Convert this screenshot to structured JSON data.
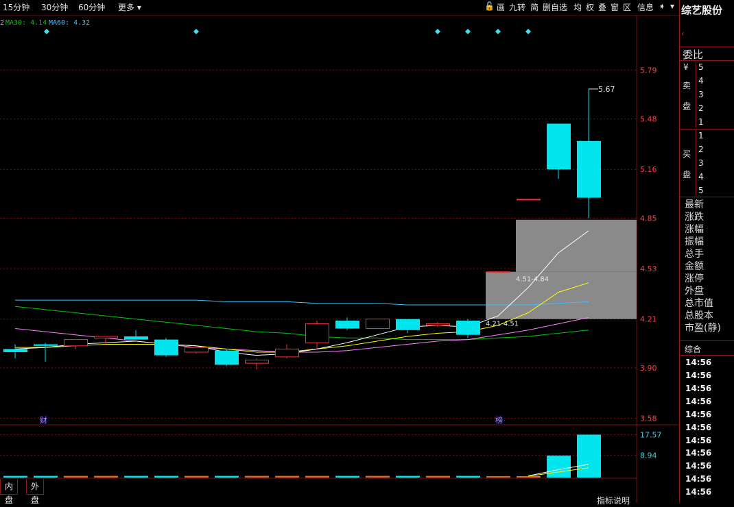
{
  "toolbar": {
    "left": [
      "15分钟",
      "30分钟",
      "60分钟",
      "更多"
    ],
    "right": [
      "画",
      "九转",
      "简",
      "删自选",
      "均",
      "权",
      "叠",
      "窗",
      "区",
      "信息"
    ]
  },
  "stock": {
    "name": "综艺股份"
  },
  "ma_label": {
    "prefix": "2",
    "ma30": "MA30: 4.14",
    "ma60": "MA60: 4.32"
  },
  "colors": {
    "up": "#ff3030",
    "down": "#00e5ee",
    "grid": "#7a1010",
    "ma5": "#ffffff",
    "ma10": "#ffff00",
    "ma20": "#ff80ff",
    "ma30": "#00cc00",
    "ma60": "#40c0ff"
  },
  "chart_data": {
    "type": "candlestick",
    "ylim": [
      3.4,
      5.95
    ],
    "y_ticks": [
      "5.79",
      "5.48",
      "5.16",
      "4.85",
      "4.53",
      "4.21",
      "3.90",
      "3.58"
    ],
    "candles": [
      {
        "o": 4.02,
        "h": 4.05,
        "l": 3.96,
        "c": 4.0
      },
      {
        "o": 4.05,
        "h": 4.06,
        "l": 3.94,
        "c": 4.04
      },
      {
        "o": 4.04,
        "h": 4.08,
        "l": 4.02,
        "c": 4.08
      },
      {
        "o": 4.09,
        "h": 4.1,
        "l": 4.05,
        "c": 4.1
      },
      {
        "o": 4.1,
        "h": 4.14,
        "l": 4.08,
        "c": 4.08
      },
      {
        "o": 4.08,
        "h": 4.09,
        "l": 3.97,
        "c": 3.98
      },
      {
        "o": 4.0,
        "h": 4.04,
        "l": 3.99,
        "c": 4.03
      },
      {
        "o": 4.01,
        "h": 4.02,
        "l": 3.91,
        "c": 3.92
      },
      {
        "o": 3.93,
        "h": 3.96,
        "l": 3.89,
        "c": 3.95
      },
      {
        "o": 3.97,
        "h": 4.05,
        "l": 3.96,
        "c": 4.02
      },
      {
        "o": 4.06,
        "h": 4.2,
        "l": 4.02,
        "c": 4.18
      },
      {
        "o": 4.2,
        "h": 4.22,
        "l": 4.14,
        "c": 4.15
      },
      {
        "o": 4.15,
        "h": 4.21,
        "l": 4.15,
        "c": 4.21
      },
      {
        "o": 4.21,
        "h": 4.21,
        "l": 4.12,
        "c": 4.14
      },
      {
        "o": 4.17,
        "h": 4.19,
        "l": 4.16,
        "c": 4.18
      },
      {
        "o": 4.2,
        "h": 4.21,
        "l": 4.09,
        "c": 4.11
      },
      {
        "o": 4.51,
        "h": 4.51,
        "l": 4.51,
        "c": 4.51
      },
      {
        "o": 4.97,
        "h": 4.97,
        "l": 4.97,
        "c": 4.97
      },
      {
        "o": 5.45,
        "h": 5.45,
        "l": 5.1,
        "c": 5.16
      },
      {
        "o": 5.34,
        "h": 5.67,
        "l": 4.85,
        "c": 4.98
      }
    ],
    "ma5": [
      4.02,
      4.03,
      4.05,
      4.06,
      4.07,
      4.05,
      4.04,
      4.0,
      3.98,
      3.99,
      4.02,
      4.06,
      4.11,
      4.16,
      4.17,
      4.16,
      4.23,
      4.41,
      4.63,
      4.77
    ],
    "ma10": [
      4.03,
      4.03,
      4.04,
      4.05,
      4.05,
      4.05,
      4.04,
      4.02,
      4.0,
      4.0,
      4.02,
      4.04,
      4.07,
      4.1,
      4.12,
      4.13,
      4.17,
      4.25,
      4.38,
      4.44
    ],
    "ma20": [
      4.15,
      4.13,
      4.11,
      4.09,
      4.07,
      4.05,
      4.03,
      4.02,
      4.01,
      4.0,
      4.0,
      4.01,
      4.03,
      4.05,
      4.07,
      4.08,
      4.11,
      4.14,
      4.18,
      4.22
    ],
    "ma30": [
      4.29,
      4.27,
      4.25,
      4.23,
      4.21,
      4.19,
      4.17,
      4.15,
      4.13,
      4.12,
      4.1,
      4.09,
      4.09,
      4.08,
      4.08,
      4.08,
      4.09,
      4.1,
      4.12,
      4.14
    ],
    "ma60": [
      4.33,
      4.33,
      4.33,
      4.33,
      4.33,
      4.33,
      4.33,
      4.32,
      4.32,
      4.32,
      4.31,
      4.31,
      4.31,
      4.3,
      4.3,
      4.3,
      4.3,
      4.3,
      4.31,
      4.32
    ],
    "gaps": [
      {
        "label": "4.51-4.84",
        "low": 4.51,
        "high": 4.84,
        "from": 16
      },
      {
        "label": "4.21-4.51",
        "low": 4.21,
        "high": 4.51,
        "from": 15
      }
    ],
    "annotation": {
      "label": "5.67",
      "value": 5.67,
      "index": 19
    },
    "markers": [
      {
        "index": 1,
        "label": ""
      },
      {
        "index": 6,
        "label": ""
      },
      {
        "index": 14,
        "label": ""
      },
      {
        "index": 15,
        "label": ""
      },
      {
        "index": 16,
        "label": ""
      },
      {
        "index": 17,
        "label": ""
      }
    ],
    "events": [
      {
        "index": 1,
        "label": "财"
      },
      {
        "index": 16,
        "label": "榜"
      }
    ],
    "volume": {
      "ylim": [
        0,
        20
      ],
      "y_ticks": [
        "17.57",
        "8.94"
      ],
      "values": [
        0.4,
        0.4,
        0.4,
        0.4,
        0.4,
        0.4,
        0.4,
        0.4,
        0.4,
        0.4,
        0.4,
        0.4,
        0.4,
        0.4,
        0.4,
        0.4,
        0.3,
        0.3,
        8.9,
        17.6
      ]
    }
  },
  "right_panel": {
    "weibi": "委比",
    "sell_label_1": "¥",
    "sell_label_2": "卖",
    "sell_label_3": "盘",
    "sell_levels": [
      "5",
      "4",
      "3",
      "2",
      "1"
    ],
    "buy_label_1": "买",
    "buy_label_2": "盘",
    "buy_levels": [
      "1",
      "2",
      "3",
      "4",
      "5"
    ],
    "fields": [
      "最新",
      "涨跌",
      "涨幅",
      "振幅",
      "总手",
      "金额",
      "涨停",
      "外盘",
      "总市值",
      "总股本",
      "市盈(静)"
    ],
    "zonghe": "综合",
    "times": [
      "14:56",
      "14:56",
      "14:56",
      "14:56",
      "14:56",
      "14:56",
      "14:56",
      "14:56",
      "14:56",
      "14:56",
      "14:56",
      "14:56"
    ]
  },
  "bottom": {
    "tabs": [
      "内盘",
      "外盘"
    ],
    "indicator_help": "指标说明"
  }
}
